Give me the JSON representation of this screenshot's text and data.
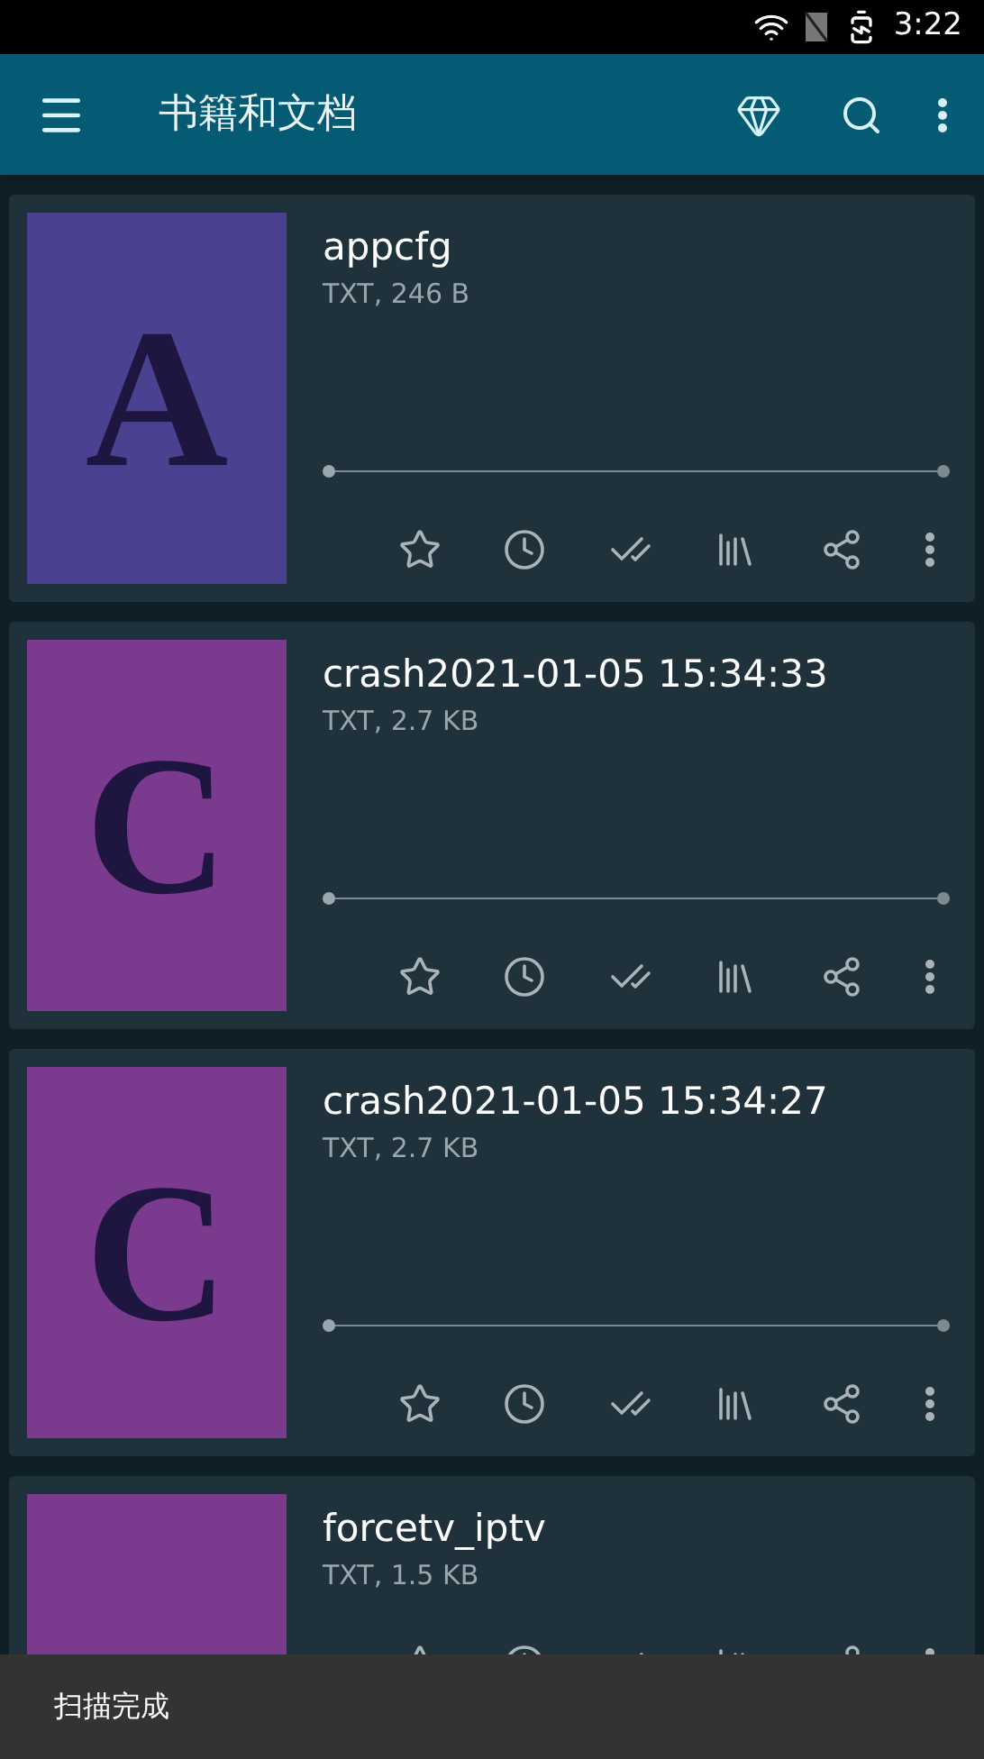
{
  "status_bar": {
    "time": "3:22"
  },
  "app_bar": {
    "title": "书籍和文档"
  },
  "books": [
    {
      "cover_letter": "A",
      "color": "#4a4290",
      "title": "appcfg",
      "info": "TXT, 246 B",
      "level": 0
    },
    {
      "cover_letter": "C",
      "color": "#7a3b8e",
      "title": "crash2021-01-05 15:34:33",
      "info": "TXT, 2.7 KB",
      "level": 0
    },
    {
      "cover_letter": "C",
      "color": "#7a3b8e",
      "title": "crash2021-01-05 15:34:27",
      "info": "TXT, 2.7 KB",
      "level": 0
    },
    {
      "color": "#7a3b8e",
      "title": "forcetv_iptv",
      "info": "TXT, 1.5 KB"
    }
  ],
  "snackbar": {
    "message": "扫描完成"
  }
}
